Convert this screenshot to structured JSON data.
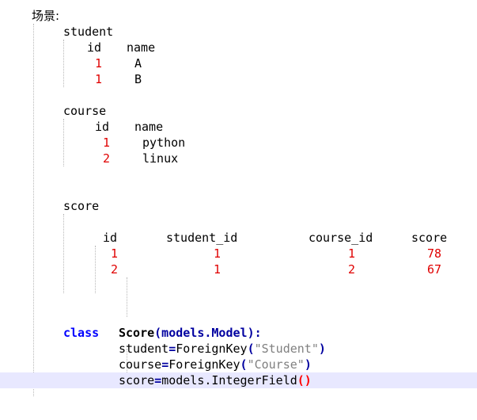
{
  "scene_label": "场景:",
  "student": {
    "title": "student",
    "header_id": "id",
    "header_name": "name",
    "rows": [
      {
        "id": "1",
        "name": "A"
      },
      {
        "id": "1",
        "name": "B"
      }
    ]
  },
  "course": {
    "title": "course",
    "header_id": "id",
    "header_name": "name",
    "rows": [
      {
        "id": "1",
        "name": "python"
      },
      {
        "id": "2",
        "name": "linux"
      }
    ]
  },
  "score": {
    "title": "score",
    "headers": [
      "id",
      "student_id",
      "course_id",
      "score"
    ],
    "rows": [
      [
        "1",
        "1",
        "1",
        "78"
      ],
      [
        "2",
        "1",
        "2",
        "67"
      ]
    ]
  },
  "code": {
    "kw_class": "class",
    "class_name": "Score",
    "base_open": "(models.Model",
    "base_close": "):",
    "line1_name": "student",
    "line1_eq": "=",
    "line1_call": "ForeignKey",
    "line1_open": "(",
    "line1_arg": "\"Student\"",
    "line1_close": ")",
    "line2_name": "course",
    "line2_eq": "=",
    "line2_call": "ForeignKey",
    "line2_open": "(",
    "line2_arg": "\"Course\"",
    "line2_close": ")",
    "line3_name": "score",
    "line3_eq": "=",
    "line3_call": "models.IntegerField",
    "line3_parens": "()"
  },
  "colors": {
    "number": "#e00000",
    "keyword": "#0000ff",
    "string": "#808080",
    "current_line": "#e8e8ff"
  }
}
